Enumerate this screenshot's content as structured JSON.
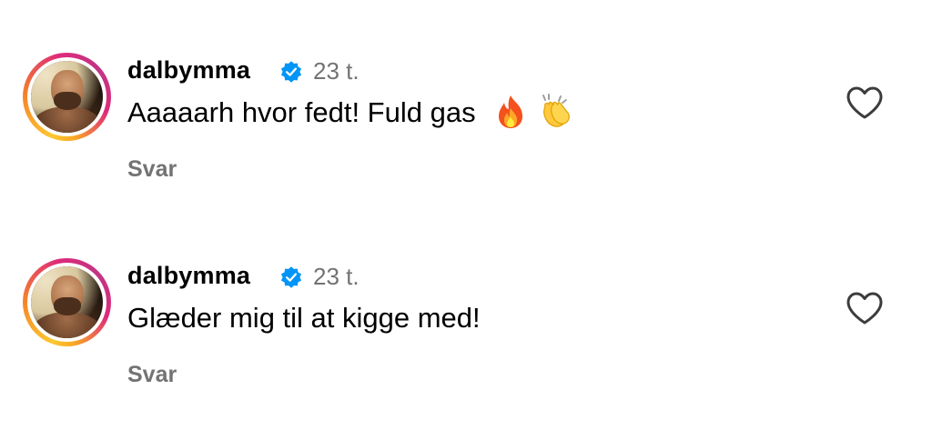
{
  "comments": [
    {
      "username": "dalbymma",
      "verified": true,
      "time": "23 t.",
      "text": "Aaaaarh hvor fedt! Fuld gas",
      "emojis": [
        "fire-emoji",
        "clapping-hands-emoji"
      ],
      "reply_label": "Svar",
      "like_icon": "heart-outline-icon"
    },
    {
      "username": "dalbymma",
      "verified": true,
      "time": "23 t.",
      "text": "Glæder mig til at kigge med!",
      "emojis": [],
      "reply_label": "Svar",
      "like_icon": "heart-outline-icon"
    }
  ],
  "colors": {
    "text_primary": "#000000",
    "text_secondary": "#737373",
    "verified_blue": "#0095f6",
    "background": "#ffffff"
  }
}
